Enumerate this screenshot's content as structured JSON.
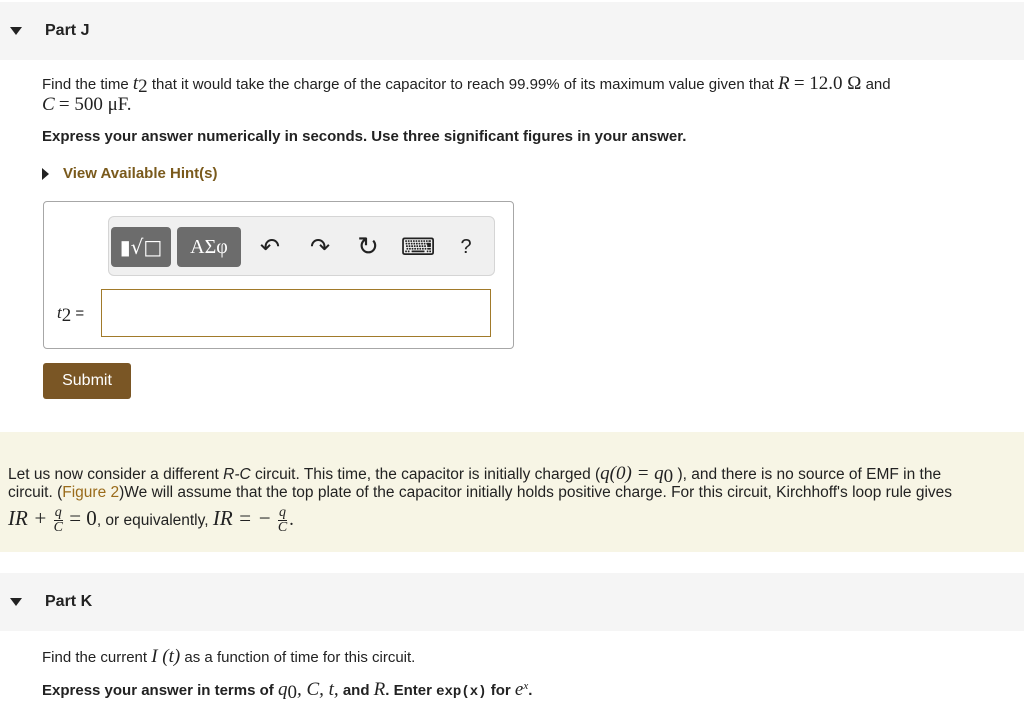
{
  "part_j": {
    "caret_icon": "triangle-down-icon",
    "title": "Part J",
    "question_prefix": "Find the time",
    "question_var": "t",
    "question_sub": "2",
    "question_middle": "that it would take the charge of the capacitor to reach 99.99% of its maximum value given that",
    "r_symbol": "R",
    "r_value": "= 12.0 Ω",
    "and": "and",
    "c_symbol": "C",
    "c_value": "= 500 μF.",
    "instruction": "Express your answer numerically in seconds. Use three significant figures in your answer.",
    "hint_label": "View Available Hint(s)",
    "toolbar": {
      "templates_label": "▮√□",
      "greek_label": "ΑΣφ",
      "undo_icon": "↶",
      "redo_icon": "↷",
      "reset_icon": "↻",
      "keyboard_icon": "⌨",
      "help_label": "?"
    },
    "answer_label_var": "t",
    "answer_label_sub": "2",
    "answer_label_eq": "=",
    "answer_value": "",
    "submit_label": "Submit"
  },
  "note": {
    "line1_a": "Let us now consider a different",
    "line1_rc": "R-C",
    "line1_b": "circuit. This time, the capacitor is initially charged (",
    "line1_q0": "q(0) = q",
    "line1_q0_sub": "0",
    "line1_c": "), and there is no source of EMF in the",
    "line2_a": "circuit. (",
    "figure_link": "Figure 2",
    "line2_b": ")We will assume that the top plate of the capacitor initially holds positive charge. For this circuit, Kirchhoff's loop rule gives",
    "eq1_a": "IR +",
    "frac_num": "q",
    "frac_den": "C",
    "eq1_b": "= 0",
    "or_text": ", or equivalently,",
    "eq2_a": "IR = −",
    "eq2_end": "."
  },
  "part_k": {
    "caret_icon": "triangle-down-icon",
    "title": "Part K",
    "question_a": "Find the current",
    "question_math": "I (t)",
    "question_b": "as a function of time for this circuit.",
    "instr_a": "Express your answer in terms of",
    "instr_vars": "q",
    "instr_vars_sub": "0",
    "instr_rest_vars": ", C, t,",
    "instr_and": "and",
    "instr_r": "R",
    "instr_enter": ". Enter",
    "instr_code": "exp(x)",
    "instr_for": "for",
    "instr_e": "e",
    "instr_x": "x",
    "instr_end": "."
  }
}
